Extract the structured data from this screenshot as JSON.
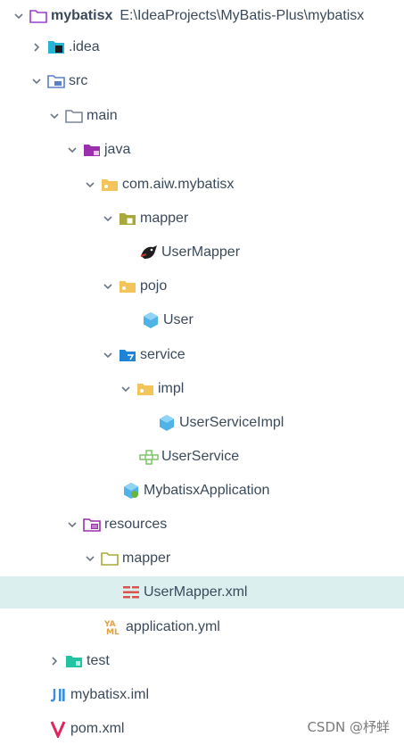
{
  "project": {
    "name": "mybatisx",
    "path": "E:\\IdeaProjects\\MyBatis-Plus\\mybatisx"
  },
  "items": {
    "idea": ".idea",
    "src": "src",
    "main": "main",
    "java": "java",
    "package": "com.aiw.mybatisx",
    "mapper": "mapper",
    "user_mapper": "UserMapper",
    "pojo": "pojo",
    "user": "User",
    "service": "service",
    "impl": "impl",
    "user_service_impl": "UserServiceImpl",
    "user_service": "UserService",
    "app": "MybatisxApplication",
    "resources": "resources",
    "res_mapper": "mapper",
    "user_mapper_xml": "UserMapper.xml",
    "app_yml": "application.yml",
    "test": "test",
    "iml": "mybatisx.iml",
    "pom": "pom.xml"
  },
  "watermark": "CSDN @杼蛘",
  "colors": {
    "selected_row": "#dcefef",
    "folder": "#f2c45a",
    "source_folder": "#9b2fae",
    "test_folder": "#22c3a0"
  }
}
